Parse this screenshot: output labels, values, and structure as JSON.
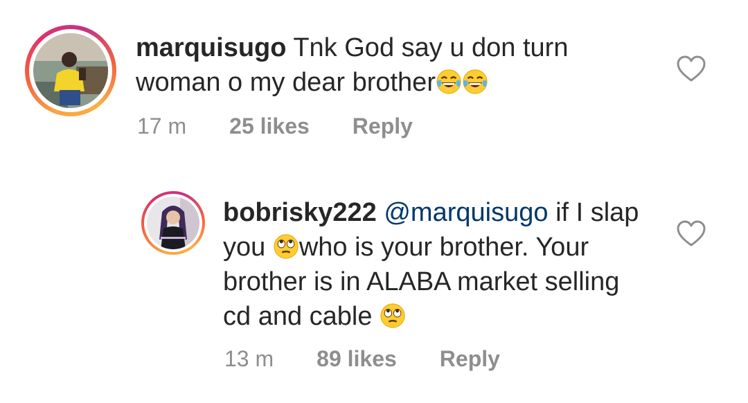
{
  "comments": [
    {
      "username": "marquisugo",
      "text": "Tnk God say u don turn woman o my dear brother",
      "emoji": [
        "face-with-tears-of-joy-icon",
        "face-with-tears-of-joy-icon"
      ],
      "time": "17 m",
      "likes": "25 likes",
      "reply": "Reply"
    },
    {
      "username": "bobrisky222",
      "mention": "@marquisugo",
      "text_part1": "if I slap you",
      "text_part2": "who is your brother. Your brother is in ALABA market selling cd and cable",
      "emoji": [
        "face-with-rolling-eyes-icon",
        "face-with-rolling-eyes-icon"
      ],
      "time": "13 m",
      "likes": "89 likes",
      "reply": "Reply"
    }
  ],
  "colors": {
    "text": "#262626",
    "meta": "#8e8e8e",
    "mention": "#00376b",
    "ring": [
      "#f9a43f",
      "#e1306c",
      "#c13584"
    ]
  }
}
